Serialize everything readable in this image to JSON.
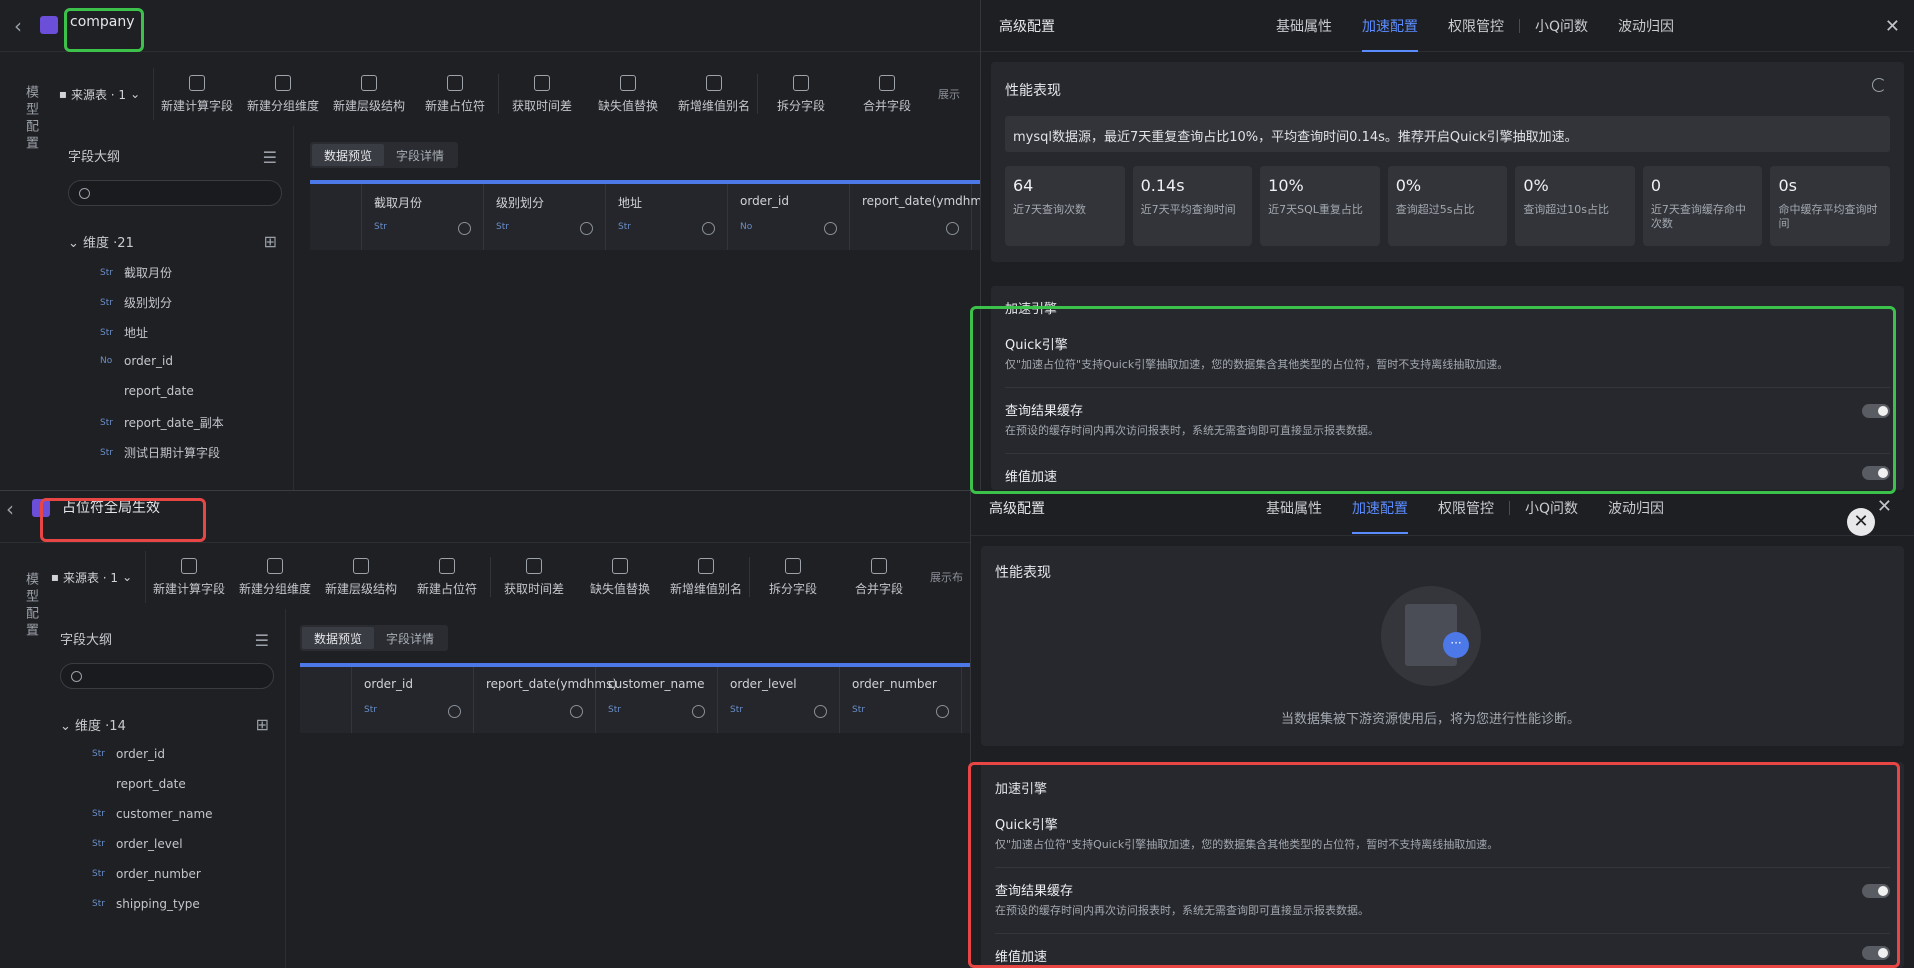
{
  "winA": {
    "title": "company",
    "vertical_label": "模型配置",
    "source": "来源表 · 1",
    "tools": [
      "新建计算字段",
      "新建分组维度",
      "新建层级结构",
      "新建占位符",
      "获取时间差",
      "缺失值替换",
      "新增维值别名",
      "拆分字段",
      "合并字段"
    ],
    "outline_title": "字段大纲",
    "dim_head": "维度 ·21",
    "fields": [
      {
        "tag": "Str",
        "name": "截取月份"
      },
      {
        "tag": "Str",
        "name": "级别划分"
      },
      {
        "tag": "Str",
        "name": "地址"
      },
      {
        "tag": "No",
        "name": "order_id"
      },
      {
        "tag": "",
        "name": "report_date"
      },
      {
        "tag": "Str",
        "name": "report_date_副本"
      },
      {
        "tag": "Str",
        "name": "测试日期计算字段"
      }
    ],
    "tabs": [
      "数据预览",
      "字段详情"
    ],
    "columns": [
      {
        "name": "截取月份",
        "tag": "Str"
      },
      {
        "name": "级别划分",
        "tag": "Str"
      },
      {
        "name": "地址",
        "tag": "Str"
      },
      {
        "name": "order_id",
        "tag": "No"
      },
      {
        "name": "report_date(ymdhms)",
        "tag": ""
      }
    ],
    "display_hint": "展示"
  },
  "panelA": {
    "title": "高级配置",
    "tabs": [
      "基础属性",
      "加速配置",
      "权限管控",
      "小Q问数",
      "波动归因"
    ],
    "perf_title": "性能表现",
    "advice": "mysql数据源，最近7天重复查询占比10%，平均查询时间0.14s。推荐开启Quick引擎抽取加速。",
    "metrics": [
      {
        "value": "64",
        "label": "近7天查询次数"
      },
      {
        "value": "0.14s",
        "label": "近7天平均查询时间"
      },
      {
        "value": "10%",
        "label": "近7天SQL重复占比"
      },
      {
        "value": "0%",
        "label": "查询超过5s占比"
      },
      {
        "value": "0%",
        "label": "查询超过10s占比"
      },
      {
        "value": "0",
        "label": "近7天查询缓存命中次数"
      },
      {
        "value": "0s",
        "label": "命中缓存平均查询时间"
      }
    ],
    "engine_title": "加速引擎",
    "rows": [
      {
        "name": "Quick引擎",
        "desc": "仅\"加速占位符\"支持Quick引擎抽取加速，您的数据集含其他类型的占位符，暂时不支持离线抽取加速。"
      },
      {
        "name": "查询结果缓存",
        "desc": "在预设的缓存时间内再次访问报表时，系统无需查询即可直接显示报表数据。"
      },
      {
        "name": "维值加速",
        "desc": ""
      }
    ]
  },
  "winB": {
    "title": "占位符全局生效",
    "vertical_label": "模型配置",
    "source": "来源表 · 1",
    "tools": [
      "新建计算字段",
      "新建分组维度",
      "新建层级结构",
      "新建占位符",
      "获取时间差",
      "缺失值替换",
      "新增维值别名",
      "拆分字段",
      "合并字段"
    ],
    "outline_title": "字段大纲",
    "dim_head": "维度 ·14",
    "fields": [
      {
        "tag": "Str",
        "name": "order_id"
      },
      {
        "tag": "",
        "name": "report_date"
      },
      {
        "tag": "Str",
        "name": "customer_name"
      },
      {
        "tag": "Str",
        "name": "order_level"
      },
      {
        "tag": "Str",
        "name": "order_number"
      },
      {
        "tag": "Str",
        "name": "shipping_type"
      }
    ],
    "tabs": [
      "数据预览",
      "字段详情"
    ],
    "columns": [
      {
        "name": "order_id",
        "tag": "Str"
      },
      {
        "name": "report_date(ymdhms)",
        "tag": ""
      },
      {
        "name": "customer_name",
        "tag": "Str"
      },
      {
        "name": "order_level",
        "tag": "Str"
      },
      {
        "name": "order_number",
        "tag": "Str"
      }
    ],
    "display_hint": "展示布"
  },
  "panelB": {
    "title": "高级配置",
    "tabs": [
      "基础属性",
      "加速配置",
      "权限管控",
      "小Q问数",
      "波动归因"
    ],
    "perf_title": "性能表现",
    "empty_text": "当数据集被下游资源使用后，将为您进行性能诊断。",
    "engine_title": "加速引擎",
    "rows": [
      {
        "name": "Quick引擎",
        "desc": "仅\"加速占位符\"支持Quick引擎抽取加速，您的数据集含其他类型的占位符，暂时不支持离线抽取加速。"
      },
      {
        "name": "查询结果缓存",
        "desc": "在预设的缓存时间内再次访问报表时，系统无需查询即可直接显示报表数据。"
      },
      {
        "name": "维值加速",
        "desc": ""
      }
    ]
  }
}
